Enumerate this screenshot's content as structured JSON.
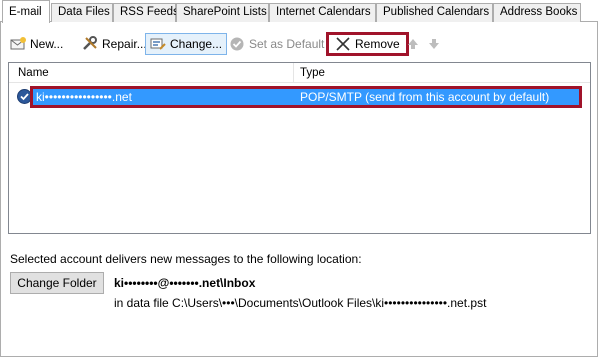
{
  "tabs": [
    {
      "label": "E-mail",
      "active": true
    },
    {
      "label": "Data Files"
    },
    {
      "label": "RSS Feeds"
    },
    {
      "label": "SharePoint Lists"
    },
    {
      "label": "Internet Calendars"
    },
    {
      "label": "Published Calendars"
    },
    {
      "label": "Address Books"
    }
  ],
  "toolbar": {
    "new_label": "New...",
    "repair_label": "Repair...",
    "change_label": "Change...",
    "set_default_label": "Set as Default",
    "remove_label": "Remove"
  },
  "list": {
    "col_name": "Name",
    "col_type": "Type",
    "account_name": "ki••••••••••••••••.net",
    "account_type": "POP/SMTP (send from this account by default)"
  },
  "delivery": {
    "text": "Selected account delivers new messages to the following location:",
    "change_folder_label": "Change Folder",
    "inbox_path": "ki••••••••@•••••••.net\\Inbox",
    "data_file": "in data file C:\\Users\\•••\\Documents\\Outlook Files\\ki•••••••••••••••.net.pst"
  },
  "colors": {
    "highlight_border": "#a0132a",
    "selection": "#3399ff"
  }
}
